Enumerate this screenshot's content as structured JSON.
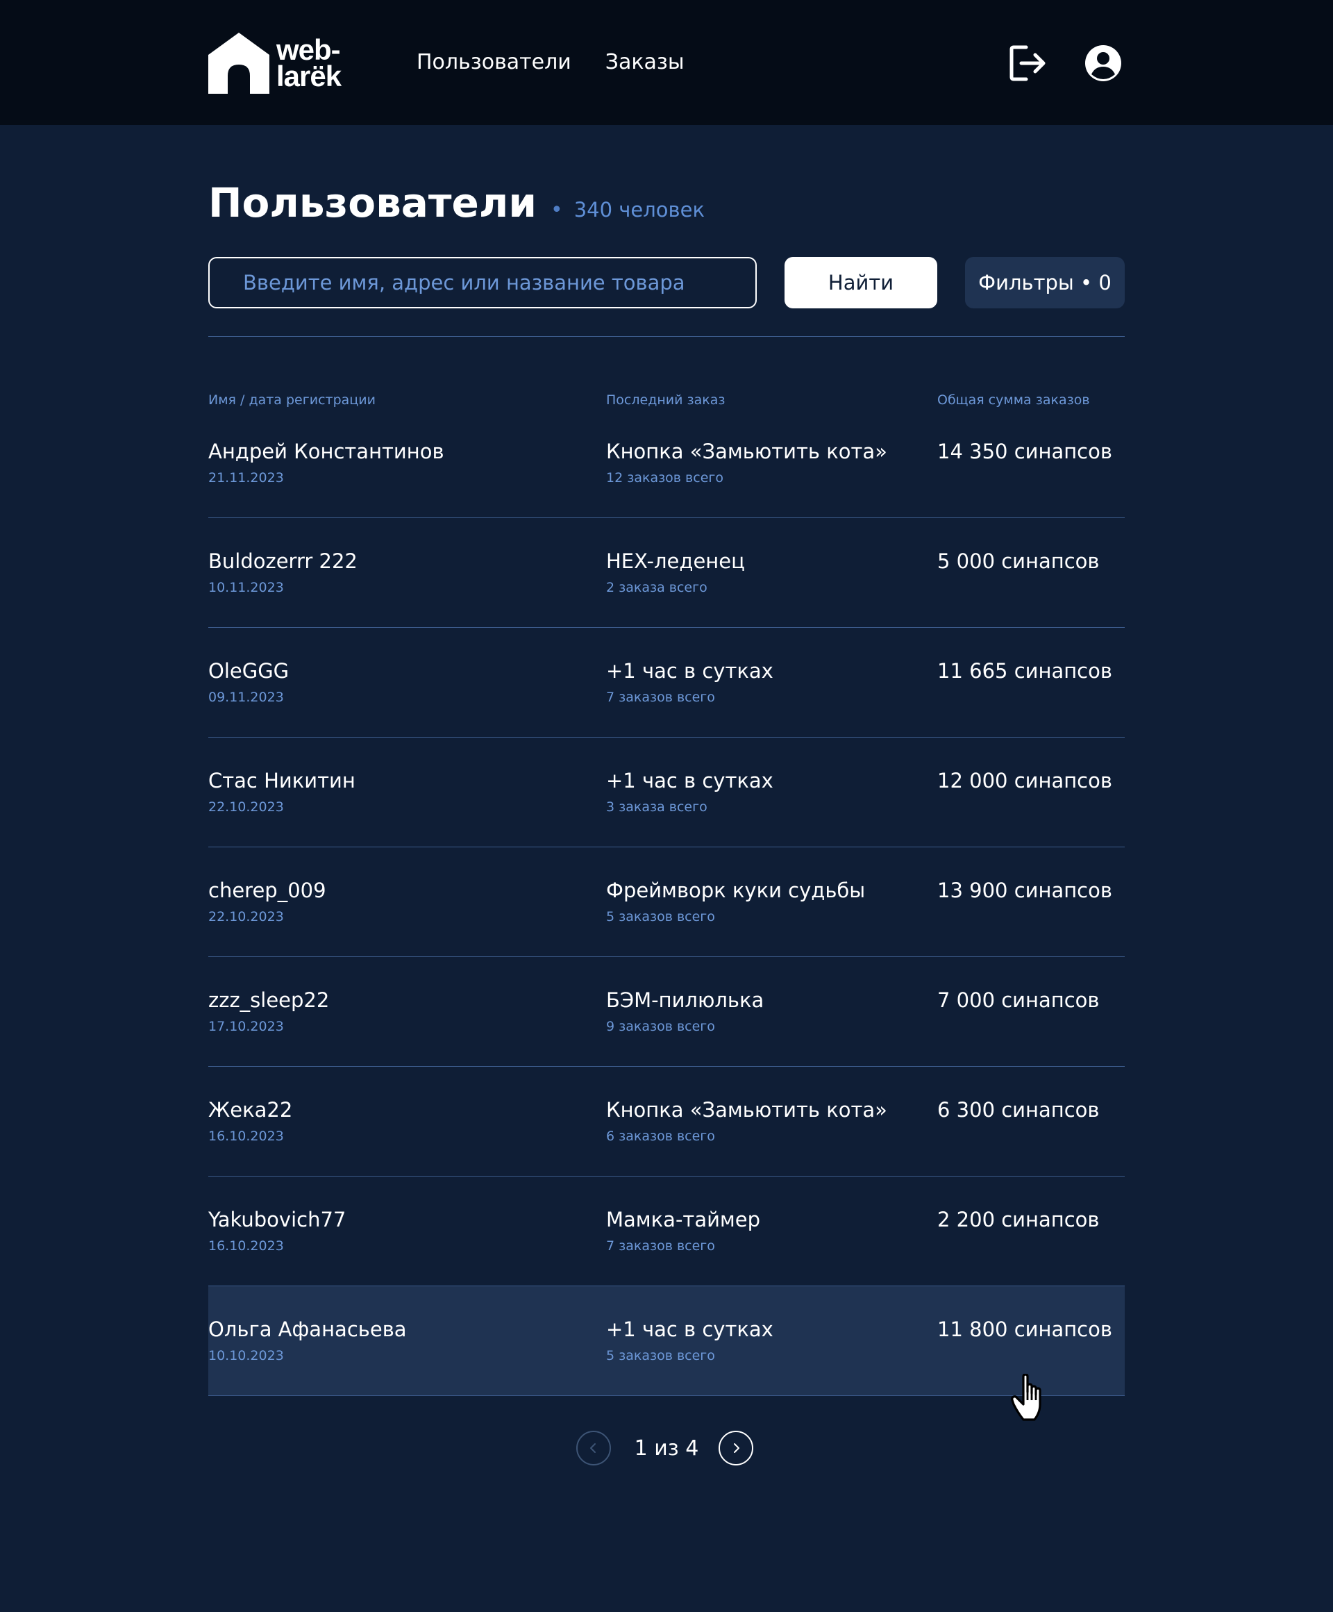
{
  "header": {
    "logo_text_line1": "web-",
    "logo_text_line2": "larёk",
    "nav": [
      "Пользователи",
      "Заказы"
    ],
    "icons": [
      "logout-icon",
      "profile-icon"
    ]
  },
  "page": {
    "title": "Пользователи",
    "count": "340 человек"
  },
  "search": {
    "placeholder": "Введите имя, адрес или название товара",
    "value": "",
    "find_label": "Найти",
    "filters_label": "Фильтры • 0"
  },
  "table": {
    "columns": [
      "Имя / дата регистрации",
      "Последний заказ",
      "Общая сумма заказов"
    ],
    "rows": [
      {
        "name": "Андрей Константинов",
        "date": "21.11.2023",
        "last_order": "Кнопка «Замьютить кота»",
        "orders_count": "12 заказов всего",
        "total": "14 350 синапсов"
      },
      {
        "name": "Buldozerrr 222",
        "date": "10.11.2023",
        "last_order": "HEX-леденец",
        "orders_count": "2 заказа всего",
        "total": "5 000 синапсов"
      },
      {
        "name": "OleGGG",
        "date": "09.11.2023",
        "last_order": "+1 час в сутках",
        "orders_count": "7 заказов всего",
        "total": "11 665 синапсов"
      },
      {
        "name": "Стас Никитин",
        "date": "22.10.2023",
        "last_order": "+1 час в сутках",
        "orders_count": "3 заказа всего",
        "total": "12 000 синапсов"
      },
      {
        "name": "cherep_009",
        "date": "22.10.2023",
        "last_order": "Фреймворк куки судьбы",
        "orders_count": "5 заказов всего",
        "total": "13 900 синапсов"
      },
      {
        "name": "zzz_sleep22",
        "date": "17.10.2023",
        "last_order": "БЭМ-пилюлька",
        "orders_count": "9 заказов всего",
        "total": "7 000 синапсов"
      },
      {
        "name": "Жека22",
        "date": "16.10.2023",
        "last_order": "Кнопка «Замьютить кота»",
        "orders_count": "6 заказов всего",
        "total": "6 300 синапсов"
      },
      {
        "name": "Yakubovich77",
        "date": "16.10.2023",
        "last_order": "Мамка-таймер",
        "orders_count": "7 заказов всего",
        "total": "2 200 синапсов"
      },
      {
        "name": "Ольга Афанасьева",
        "date": "10.10.2023",
        "last_order": "+1 час в сутках",
        "orders_count": "5 заказов всего",
        "total": "11 800 синапсов"
      }
    ],
    "hovered_row": 8
  },
  "pagination": {
    "label": "1 из 4",
    "icons": [
      "chevron-left-icon",
      "chevron-right-icon"
    ]
  },
  "colors": {
    "background": "#0f1e36",
    "header": "#050c17",
    "accent_text": "#6d98d8",
    "hover_row": "#1f3352"
  }
}
